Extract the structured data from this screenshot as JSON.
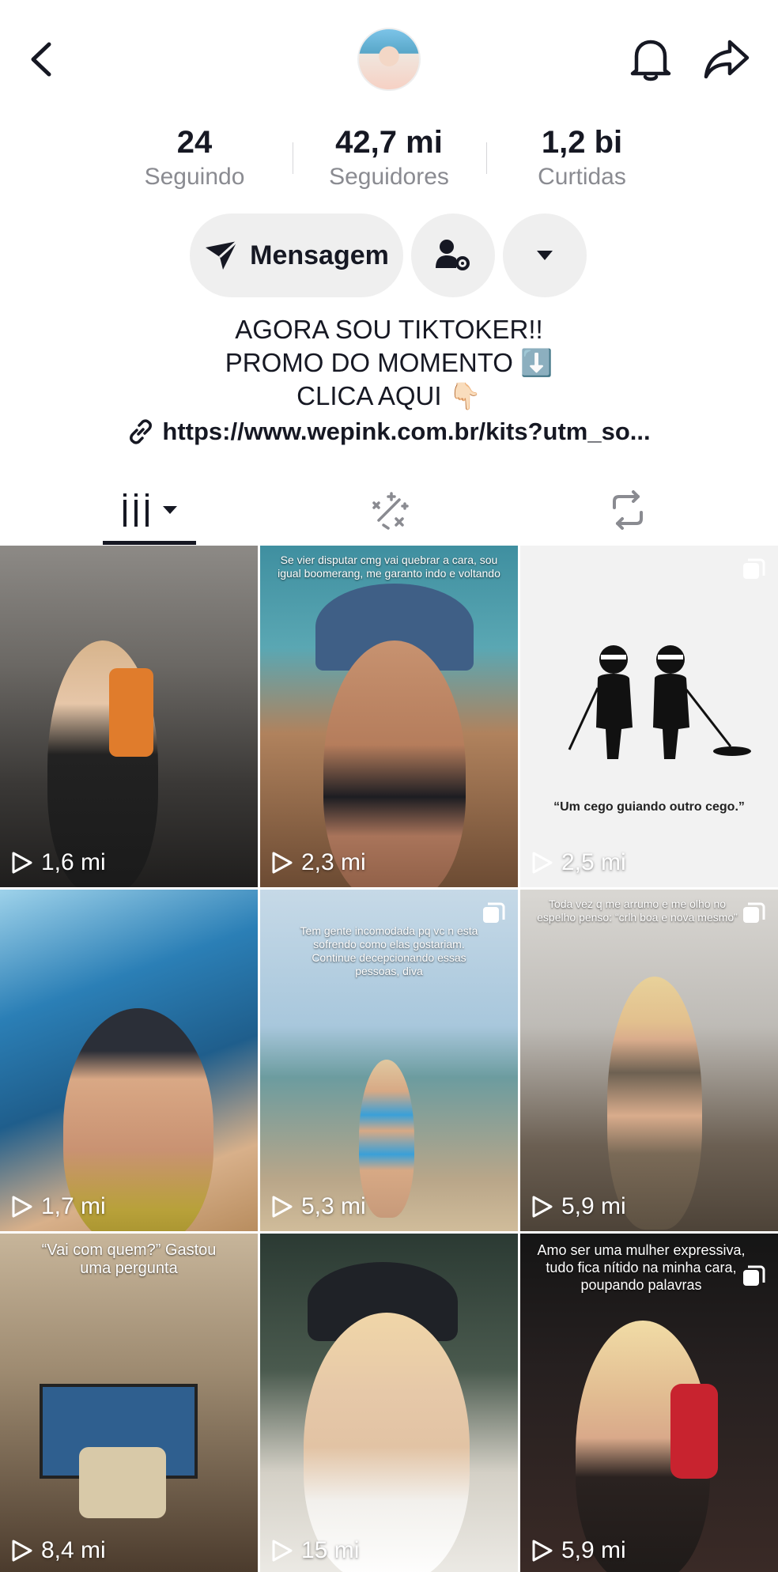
{
  "header": {
    "back_icon": "chevron-left-icon",
    "notification_icon": "bell-icon",
    "share_icon": "share-arrow-icon"
  },
  "stats": [
    {
      "value": "24",
      "label": "Seguindo"
    },
    {
      "value": "42,7 mi",
      "label": "Seguidores"
    },
    {
      "value": "1,2 bi",
      "label": "Curtidas"
    }
  ],
  "actions": {
    "message_label": "Mensagem",
    "message_icon": "send-icon",
    "follow_icon": "user-settings-icon",
    "more_icon": "caret-down-icon"
  },
  "bio": {
    "line1": "AGORA SOU TIKTOKER!!",
    "line2": "PROMO DO MOMENTO ⬇️",
    "line3": "CLICA AQUI 👇🏻",
    "link": "https://www.wepink.com.br/kits?utm_so..."
  },
  "tabs": [
    {
      "name": "videos",
      "icon": "grid-videos-icon"
    },
    {
      "name": "favorites",
      "icon": "sparkle-icon"
    },
    {
      "name": "reposts",
      "icon": "repost-icon"
    }
  ],
  "videos": [
    {
      "views": "1,6 mi",
      "caption": ""
    },
    {
      "views": "2,3 mi",
      "caption": "Se vier disputar cmg vai quebrar a cara, sou igual boomerang, me garanto indo e voltando"
    },
    {
      "views": "2,5 mi",
      "caption": "“Um cego guiando outro cego.”"
    },
    {
      "views": "1,7 mi",
      "caption": ""
    },
    {
      "views": "5,3 mi",
      "caption": "Tem gente incomodada pq vc n esta sofrendo como elas gostariam. Continue decepcionando essas pessoas, diva"
    },
    {
      "views": "5,9 mi",
      "caption": "Toda vez q me arrumo e me olho no espelho penso: “crlh boa e nova mesmo”"
    },
    {
      "views": "8,4 mi",
      "caption": "“Vai com quem?” Gastou uma pergunta"
    },
    {
      "views": "15 mi",
      "caption": ""
    },
    {
      "views": "5,9 mi",
      "caption": "Amo ser uma mulher expressiva, tudo fica nítido na minha cara, poupando palavras"
    }
  ]
}
